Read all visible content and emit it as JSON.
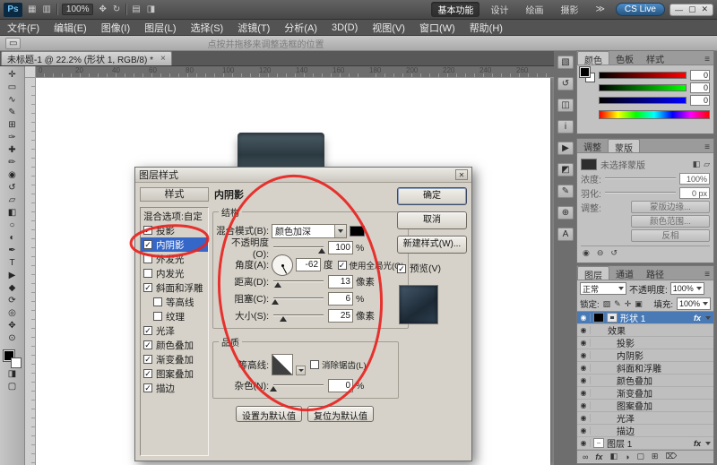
{
  "accent": {
    "annotation_red": "#e8231f",
    "selection_blue": "#3467c8"
  },
  "titlebar": {
    "logo": "Ps",
    "icons": [
      {
        "name": "bridge",
        "glyph": "▦"
      },
      {
        "name": "view-extras",
        "glyph": "▥"
      },
      {
        "name": "hand",
        "glyph": "✥"
      },
      {
        "name": "rotate-view",
        "glyph": "↻"
      },
      {
        "name": "arrange-documents",
        "glyph": "▤"
      },
      {
        "name": "screen-mode",
        "glyph": "◨"
      }
    ],
    "zoom_level": "100%",
    "workspaces": [
      "基本功能",
      "设计",
      "绘画",
      "摄影"
    ],
    "overflow": "≫",
    "cslive": "CS Live",
    "window_controls": [
      "—",
      "▢",
      "✕"
    ]
  },
  "menubar": {
    "items": [
      "文件(F)",
      "编辑(E)",
      "图像(I)",
      "图层(L)",
      "选择(S)",
      "滤镜(T)",
      "分析(A)",
      "3D(D)",
      "视图(V)",
      "窗口(W)",
      "帮助(H)"
    ]
  },
  "optionsbar": {
    "tool_glyph": "▭",
    "hint": "点按并拖移来调整选框的位置"
  },
  "document": {
    "tab_title": "未标题-1 @ 22.2% (形状 1, RGB/8) *",
    "tab_close": "×",
    "ruler_ticks": [
      "0",
      "20",
      "40",
      "60",
      "80",
      "100",
      "120",
      "140",
      "160",
      "180",
      "200",
      "220",
      "240",
      "260"
    ]
  },
  "toolbar": {
    "tools": [
      {
        "name": "move",
        "glyph": "✛"
      },
      {
        "name": "marquee",
        "glyph": "▭"
      },
      {
        "name": "lasso",
        "glyph": "∿"
      },
      {
        "name": "quick-selection",
        "glyph": "✎"
      },
      {
        "name": "crop",
        "glyph": "⊞"
      },
      {
        "name": "eyedropper",
        "glyph": "✑"
      },
      {
        "name": "healing-brush",
        "glyph": "✚"
      },
      {
        "name": "brush",
        "glyph": "✏"
      },
      {
        "name": "clone-stamp",
        "glyph": "◉"
      },
      {
        "name": "history-brush",
        "glyph": "↺"
      },
      {
        "name": "eraser",
        "glyph": "▱"
      },
      {
        "name": "gradient",
        "glyph": "◧"
      },
      {
        "name": "blur",
        "glyph": "○"
      },
      {
        "name": "dodge",
        "glyph": "◐"
      },
      {
        "name": "pen",
        "glyph": "✒"
      },
      {
        "name": "type",
        "glyph": "T"
      },
      {
        "name": "path-selection",
        "glyph": "▶"
      },
      {
        "name": "shape",
        "glyph": "◆"
      },
      {
        "name": "3d-rotate",
        "glyph": "⟳"
      },
      {
        "name": "3d-orbit",
        "glyph": "◎"
      },
      {
        "name": "hand",
        "glyph": "✥"
      },
      {
        "name": "zoom",
        "glyph": "⊙"
      }
    ],
    "extra": [
      {
        "name": "quick-mask",
        "glyph": "◨"
      },
      {
        "name": "screen-mode",
        "glyph": "▢"
      }
    ]
  },
  "dialog": {
    "title": "图层样式",
    "close": "✕",
    "styles_header": "样式",
    "blending_row": "混合选项:自定",
    "style_items": [
      {
        "label": "投影",
        "check": "✓"
      },
      {
        "label": "内阴影",
        "check": "✓"
      },
      {
        "label": "外发光",
        "check": ""
      },
      {
        "label": "内发光",
        "check": ""
      },
      {
        "label": "斜面和浮雕",
        "check": "✓"
      },
      {
        "label": "等高线",
        "check": ""
      },
      {
        "label": "纹理",
        "check": ""
      },
      {
        "label": "光泽",
        "check": "✓"
      },
      {
        "label": "颜色叠加",
        "check": "✓"
      },
      {
        "label": "渐变叠加",
        "check": "✓"
      },
      {
        "label": "图案叠加",
        "check": "✓"
      },
      {
        "label": "描边",
        "check": "✓"
      }
    ],
    "panel_title": "内阴影",
    "structure": {
      "legend": "结构",
      "blend_mode_label": "混合模式(B):",
      "blend_mode_value": "颜色加深",
      "opacity_label": "不透明度(O):",
      "opacity_value": "100",
      "opacity_unit": "%",
      "angle_label": "角度(A):",
      "angle_value": "-62",
      "angle_unit": "度",
      "global_light_check": "✓",
      "global_light_label": "使用全局光(G)",
      "distance_label": "距离(D):",
      "distance_value": "13",
      "distance_unit": "像素",
      "choke_label": "阻塞(C):",
      "choke_value": "6",
      "choke_unit": "%",
      "size_label": "大小(S):",
      "size_value": "25",
      "size_unit": "像素"
    },
    "quality": {
      "legend": "品质",
      "contour_label": "等高线:",
      "antialias_check": "",
      "antialias_label": "消除锯齿(L)",
      "noise_label": "杂色(N):",
      "noise_value": "0",
      "noise_unit": "%"
    },
    "set_default": "设置为默认值",
    "reset_default": "复位为默认值",
    "ok": "确定",
    "cancel": "取消",
    "new_style": "新建样式(W)...",
    "preview_check": "✓",
    "preview_label": "预览(V)"
  },
  "panels": {
    "icon_strip": [
      {
        "name": "mini-bridge",
        "glyph": "▧"
      },
      {
        "name": "history",
        "glyph": "↺"
      },
      {
        "name": "layer-comps",
        "glyph": "◫"
      },
      {
        "name": "info",
        "glyph": "i"
      },
      {
        "name": "actions",
        "glyph": "▶"
      },
      {
        "name": "styles",
        "glyph": "◩"
      },
      {
        "name": "brush-presets",
        "glyph": "✎"
      },
      {
        "name": "clone-source",
        "glyph": "⊕"
      },
      {
        "name": "character",
        "glyph": "A"
      }
    ],
    "color": {
      "tabs": [
        "颜色",
        "色板",
        "样式"
      ],
      "menu_icon": "≡",
      "values": [
        "0",
        "0",
        "0"
      ]
    },
    "masks": {
      "tabs": [
        "调整",
        "蒙版"
      ],
      "menu_icon": "≡",
      "title": "未选择蒙版",
      "add_icons": [
        "◧",
        "▱"
      ],
      "density_label": "浓度:",
      "density_value": "100%",
      "feather_label": "羽化:",
      "feather_value": "0 px",
      "adjust_label": "调整:",
      "mask_edge": "蒙版边缘...",
      "color_range": "颜色范围...",
      "invert": "反相",
      "footer_icons": [
        "◉",
        "⊖",
        "↺"
      ]
    },
    "layers": {
      "tabs": [
        "图层",
        "通道",
        "路径"
      ],
      "menu_icon": "≡",
      "blend_mode": "正常",
      "opacity_label": "不透明度:",
      "opacity_value": "100%",
      "lock_label": "锁定:",
      "lock_icons": [
        "▨",
        "✎",
        "✛",
        "▣"
      ],
      "fill_label": "填充:",
      "fill_value": "100%",
      "rows": {
        "eye": "◉",
        "shape_name": "形状 1",
        "fx": "fx",
        "effects_header": "效果",
        "effects": [
          "投影",
          "内阴影",
          "斜面和浮雕",
          "颜色叠加",
          "渐变叠加",
          "图案叠加",
          "光泽",
          "描边"
        ],
        "layer1_name": "图层 1"
      },
      "footer_icons": [
        "∞",
        "fx",
        "◧",
        "◑",
        "▢",
        "⊞",
        "⌦"
      ]
    }
  }
}
